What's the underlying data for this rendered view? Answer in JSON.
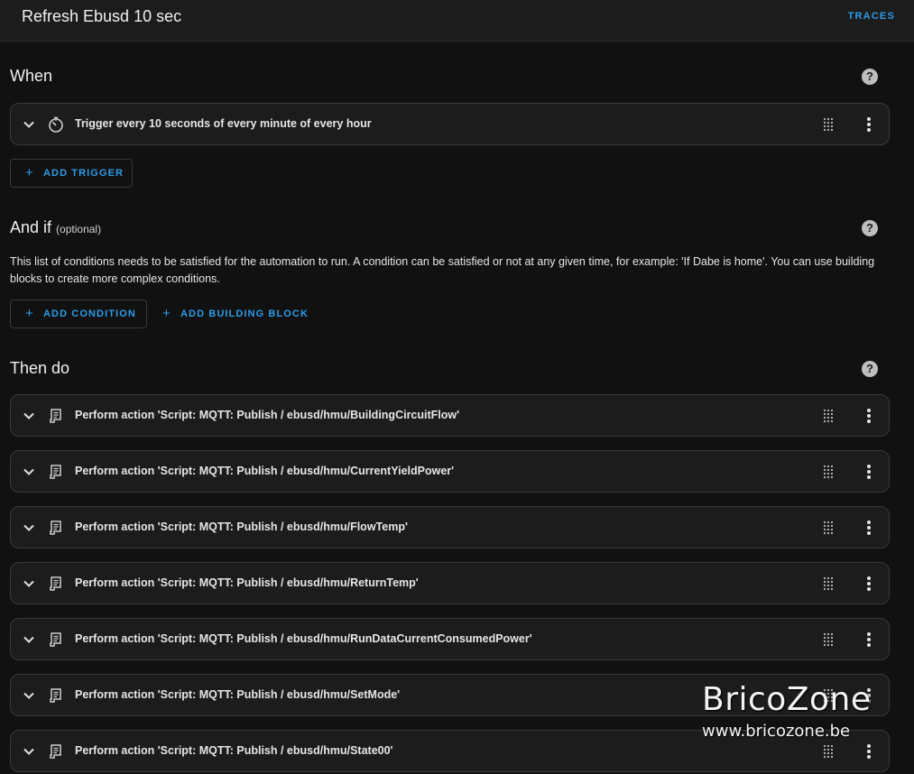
{
  "header": {
    "title": "Refresh Ebusd 10 sec",
    "traces_label": "TRACES"
  },
  "when": {
    "title": "When",
    "help": "?",
    "trigger": {
      "icon": "timer-icon",
      "label": "Trigger every 10 seconds of every minute of every hour"
    },
    "add_trigger_label": "ADD TRIGGER",
    "plus": "+"
  },
  "andif": {
    "title": "And if",
    "optional": "(optional)",
    "help": "?",
    "description": "This list of conditions needs to be satisfied for the automation to run. A condition can be satisfied or not at any given time, for example: 'If Dabe is home'. You can use building blocks to create more complex conditions.",
    "add_condition_label": "ADD CONDITION",
    "add_building_block_label": "ADD BUILDING BLOCK",
    "plus": "+"
  },
  "thendo": {
    "title": "Then do",
    "help": "?",
    "actions": [
      {
        "icon": "script-icon",
        "label": "Perform action 'Script: MQTT: Publish / ebusd/hmu/BuildingCircuitFlow'"
      },
      {
        "icon": "script-icon",
        "label": "Perform action 'Script: MQTT: Publish / ebusd/hmu/CurrentYieldPower'"
      },
      {
        "icon": "script-icon",
        "label": "Perform action 'Script: MQTT: Publish / ebusd/hmu/FlowTemp'"
      },
      {
        "icon": "script-icon",
        "label": "Perform action 'Script: MQTT: Publish / ebusd/hmu/ReturnTemp'"
      },
      {
        "icon": "script-icon",
        "label": "Perform action 'Script: MQTT: Publish / ebusd/hmu/RunDataCurrentConsumedPower'"
      },
      {
        "icon": "script-icon",
        "label": "Perform action 'Script: MQTT: Publish / ebusd/hmu/SetMode'"
      },
      {
        "icon": "script-icon",
        "label": "Perform action 'Script: MQTT: Publish / ebusd/hmu/State00'"
      }
    ]
  },
  "watermark": {
    "line1": "BricoZone",
    "line2": "www.bricozone.be"
  },
  "colors": {
    "accent": "#2d9be6",
    "background": "#111111",
    "card": "#1c1c1c",
    "border": "#3a3a3a"
  }
}
